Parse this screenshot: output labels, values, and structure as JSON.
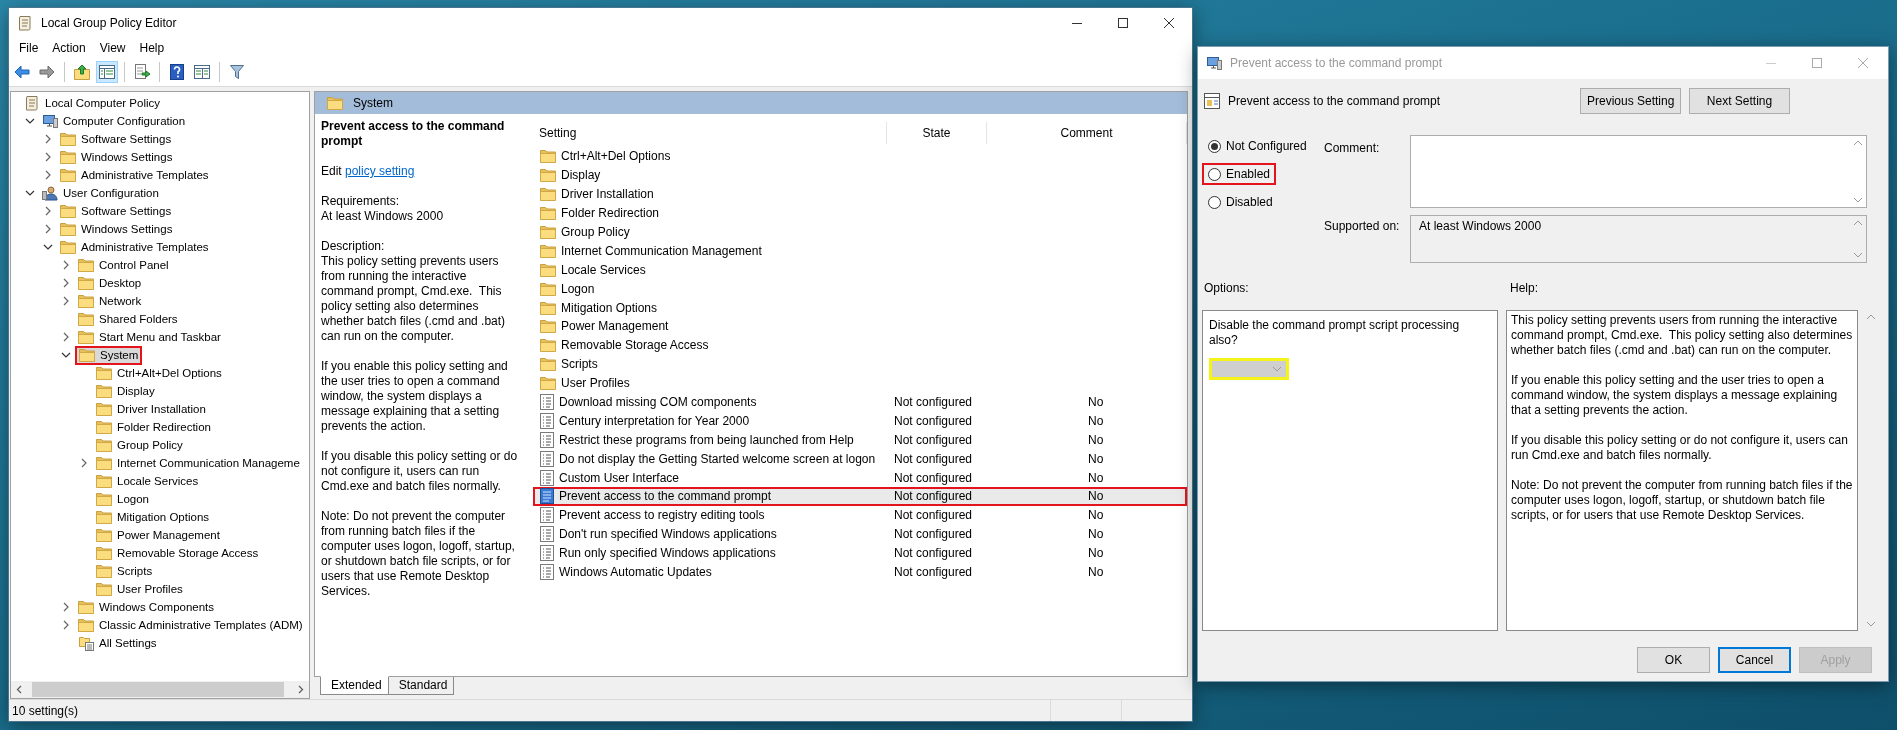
{
  "main_window": {
    "title": "Local Group Policy Editor",
    "menu": [
      "File",
      "Action",
      "View",
      "Help"
    ],
    "toolbar": [
      {
        "kind": "back",
        "pressed": false
      },
      {
        "kind": "forward",
        "pressed": false
      },
      {
        "kind": "up",
        "pressed": false
      },
      {
        "kind": "tree",
        "pressed": true
      },
      {
        "kind": "export",
        "pressed": false
      },
      {
        "kind": "help",
        "pressed": false
      },
      {
        "kind": "view",
        "pressed": false
      },
      {
        "kind": "filter",
        "pressed": false
      }
    ],
    "tree": [
      {
        "label": "Local Computer Policy",
        "kind": "root",
        "selected": false,
        "children": [
          {
            "label": "Computer Configuration",
            "kind": "computer",
            "expandable": true,
            "expanded": true,
            "selected": false,
            "children": [
              {
                "label": "Software Settings",
                "kind": "folder",
                "expandable": true,
                "expanded": false,
                "selected": false
              },
              {
                "label": "Windows Settings",
                "kind": "folder",
                "expandable": true,
                "expanded": false,
                "selected": false
              },
              {
                "label": "Administrative Templates",
                "kind": "folder",
                "expandable": true,
                "expanded": false,
                "selected": false
              }
            ]
          },
          {
            "label": "User Configuration",
            "kind": "user",
            "expandable": true,
            "expanded": true,
            "selected": false,
            "children": [
              {
                "label": "Software Settings",
                "kind": "folder",
                "expandable": true,
                "expanded": false,
                "selected": false
              },
              {
                "label": "Windows Settings",
                "kind": "folder",
                "expandable": true,
                "expanded": false,
                "selected": false
              },
              {
                "label": "Administrative Templates",
                "kind": "folder",
                "expandable": true,
                "expanded": true,
                "selected": false,
                "children": [
                  {
                    "label": "Control Panel",
                    "kind": "folder",
                    "expandable": true,
                    "expanded": false,
                    "selected": false
                  },
                  {
                    "label": "Desktop",
                    "kind": "folder",
                    "expandable": true,
                    "expanded": false,
                    "selected": false
                  },
                  {
                    "label": "Network",
                    "kind": "folder",
                    "expandable": true,
                    "expanded": false,
                    "selected": false
                  },
                  {
                    "label": "Shared Folders",
                    "kind": "folder",
                    "expandable": false,
                    "selected": false
                  },
                  {
                    "label": "Start Menu and Taskbar",
                    "kind": "folder",
                    "expandable": true,
                    "expanded": false,
                    "selected": false
                  },
                  {
                    "label": "System",
                    "kind": "folder",
                    "expandable": true,
                    "expanded": true,
                    "selected": true,
                    "children": [
                      {
                        "label": "Ctrl+Alt+Del Options",
                        "kind": "folder",
                        "expandable": false,
                        "selected": false
                      },
                      {
                        "label": "Display",
                        "kind": "folder",
                        "expandable": false,
                        "selected": false
                      },
                      {
                        "label": "Driver Installation",
                        "kind": "folder",
                        "expandable": false,
                        "selected": false
                      },
                      {
                        "label": "Folder Redirection",
                        "kind": "folder",
                        "expandable": false,
                        "selected": false
                      },
                      {
                        "label": "Group Policy",
                        "kind": "folder",
                        "expandable": false,
                        "selected": false
                      },
                      {
                        "label": "Internet Communication Manageme",
                        "kind": "folder",
                        "expandable": true,
                        "expanded": false,
                        "selected": false
                      },
                      {
                        "label": "Locale Services",
                        "kind": "folder",
                        "expandable": false,
                        "selected": false
                      },
                      {
                        "label": "Logon",
                        "kind": "folder",
                        "expandable": false,
                        "selected": false
                      },
                      {
                        "label": "Mitigation Options",
                        "kind": "folder",
                        "expandable": false,
                        "selected": false
                      },
                      {
                        "label": "Power Management",
                        "kind": "folder",
                        "expandable": false,
                        "selected": false
                      },
                      {
                        "label": "Removable Storage Access",
                        "kind": "folder",
                        "expandable": false,
                        "selected": false
                      },
                      {
                        "label": "Scripts",
                        "kind": "folder",
                        "expandable": false,
                        "selected": false
                      },
                      {
                        "label": "User Profiles",
                        "kind": "folder",
                        "expandable": false,
                        "selected": false
                      }
                    ]
                  },
                  {
                    "label": "Windows Components",
                    "kind": "folder",
                    "expandable": true,
                    "expanded": false,
                    "selected": false
                  },
                  {
                    "label": "Classic Administrative Templates (ADM)",
                    "kind": "folder",
                    "expandable": true,
                    "expanded": false,
                    "selected": false
                  },
                  {
                    "label": "All Settings",
                    "kind": "all-settings",
                    "expandable": false,
                    "selected": false
                  }
                ]
              }
            ]
          }
        ]
      }
    ],
    "details_header": "System",
    "description": {
      "title": "Prevent access to the command prompt",
      "edit_prefix": "Edit",
      "edit_link": "policy setting",
      "requirements_label": "Requirements:",
      "requirements": "At least Windows 2000",
      "description_label": "Description:",
      "paragraphs": [
        "This policy setting prevents users from running the interactive command prompt, Cmd.exe.  This policy setting also determines whether batch files (.cmd and .bat) can run on the computer.",
        "If you enable this policy setting and the user tries to open a command window, the system displays a message explaining that a setting prevents the action.",
        "If you disable this policy setting or do not configure it, users can run Cmd.exe and batch files normally.",
        "Note: Do not prevent the computer from running batch files if the computer uses logon, logoff, startup, or shutdown batch file scripts, or for users that use Remote Desktop Services."
      ]
    },
    "list": {
      "columns": [
        "Setting",
        "State",
        "Comment"
      ],
      "rows": [
        {
          "kind": "folder",
          "setting": "Ctrl+Alt+Del Options",
          "selected": false
        },
        {
          "kind": "folder",
          "setting": "Display",
          "selected": false
        },
        {
          "kind": "folder",
          "setting": "Driver Installation",
          "selected": false
        },
        {
          "kind": "folder",
          "setting": "Folder Redirection",
          "selected": false
        },
        {
          "kind": "folder",
          "setting": "Group Policy",
          "selected": false
        },
        {
          "kind": "folder",
          "setting": "Internet Communication Management",
          "selected": false
        },
        {
          "kind": "folder",
          "setting": "Locale Services",
          "selected": false
        },
        {
          "kind": "folder",
          "setting": "Logon",
          "selected": false
        },
        {
          "kind": "folder",
          "setting": "Mitigation Options",
          "selected": false
        },
        {
          "kind": "folder",
          "setting": "Power Management",
          "selected": false
        },
        {
          "kind": "folder",
          "setting": "Removable Storage Access",
          "selected": false
        },
        {
          "kind": "folder",
          "setting": "Scripts",
          "selected": false
        },
        {
          "kind": "folder",
          "setting": "User Profiles",
          "selected": false
        },
        {
          "kind": "policy",
          "setting": "Download missing COM components",
          "state": "Not configured",
          "comment": "No",
          "selected": false
        },
        {
          "kind": "policy",
          "setting": "Century interpretation for Year 2000",
          "state": "Not configured",
          "comment": "No",
          "selected": false
        },
        {
          "kind": "policy",
          "setting": "Restrict these programs from being launched from Help",
          "state": "Not configured",
          "comment": "No",
          "selected": false
        },
        {
          "kind": "policy",
          "setting": "Do not display the Getting Started welcome screen at logon",
          "state": "Not configured",
          "comment": "No",
          "selected": false
        },
        {
          "kind": "policy",
          "setting": "Custom User Interface",
          "state": "Not configured",
          "comment": "No",
          "selected": false
        },
        {
          "kind": "policy",
          "setting": "Prevent access to the command prompt",
          "state": "Not configured",
          "comment": "No",
          "selected": true
        },
        {
          "kind": "policy",
          "setting": "Prevent access to registry editing tools",
          "state": "Not configured",
          "comment": "No",
          "selected": false
        },
        {
          "kind": "policy",
          "setting": "Don't run specified Windows applications",
          "state": "Not configured",
          "comment": "No",
          "selected": false
        },
        {
          "kind": "policy",
          "setting": "Run only specified Windows applications",
          "state": "Not configured",
          "comment": "No",
          "selected": false
        },
        {
          "kind": "policy",
          "setting": "Windows Automatic Updates",
          "state": "Not configured",
          "comment": "No",
          "selected": false
        }
      ]
    },
    "view_tabs": [
      {
        "label": "Extended",
        "selected": true
      },
      {
        "label": "Standard",
        "selected": false
      }
    ],
    "status_bar": "10 setting(s)"
  },
  "dialog": {
    "title": "Prevent access to the command prompt",
    "heading": "Prevent access to the command prompt",
    "nav_buttons": [
      "Previous Setting",
      "Next Setting"
    ],
    "options": [
      {
        "label": "Not Configured",
        "selected": true,
        "highlighted": false
      },
      {
        "label": "Enabled",
        "selected": false,
        "highlighted": true
      },
      {
        "label": "Disabled",
        "selected": false,
        "highlighted": false
      }
    ],
    "comment_label": "Comment:",
    "supported_label": "Supported on:",
    "supported_value": "At least Windows 2000",
    "options_label": "Options:",
    "help_label": "Help:",
    "option_prompt": "Disable the command prompt script processing also?",
    "dropdown": {
      "disabled": true,
      "highlighted": true
    },
    "help": [
      "This policy setting prevents users from running the interactive command prompt, Cmd.exe.  This policy setting also determines whether batch files (.cmd and .bat) can run on the computer.",
      "If you enable this policy setting and the user tries to open a command window, the system displays a message explaining that a setting prevents the action.",
      "If you disable this policy setting or do not configure it, users can run Cmd.exe and batch files normally.",
      "Note: Do not prevent the computer from running batch files if the computer uses logon, logoff, startup, or shutdown batch file scripts, or for users that use Remote Desktop Services."
    ],
    "buttons": [
      {
        "label": "OK",
        "default": false,
        "disabled": false
      },
      {
        "label": "Cancel",
        "default": true,
        "disabled": false
      },
      {
        "label": "Apply",
        "default": false,
        "disabled": true
      }
    ]
  }
}
